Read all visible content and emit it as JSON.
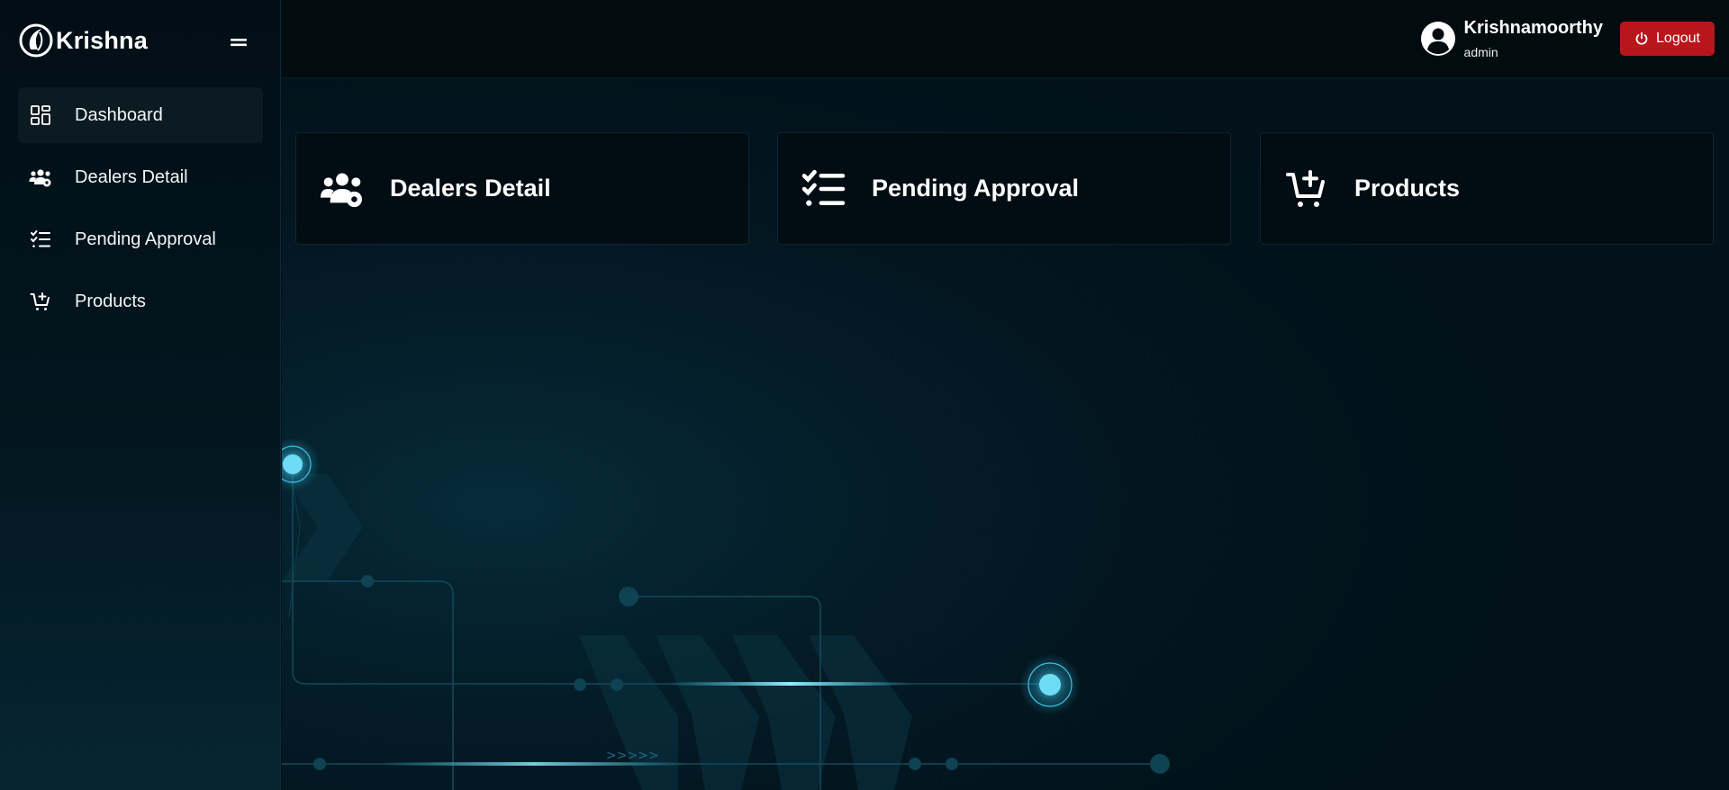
{
  "brand": {
    "name": "Krishna",
    "logo_icon": "krishna-logo"
  },
  "sidebar": {
    "toggle_icon": "menu-toggle-icon",
    "items": [
      {
        "label": "Dashboard",
        "icon": "dashboard-icon",
        "active": true
      },
      {
        "label": "Dealers Detail",
        "icon": "dealers-icon",
        "active": false
      },
      {
        "label": "Pending Approval",
        "icon": "checklist-icon",
        "active": false
      },
      {
        "label": "Products",
        "icon": "cart-plus-icon",
        "active": false
      }
    ]
  },
  "header": {
    "user": {
      "name": "Krishnamoorthy",
      "role": "admin",
      "icon": "user-avatar-icon"
    },
    "logout_label": "Logout",
    "logout_icon": "power-icon"
  },
  "cards": [
    {
      "label": "Dealers Detail",
      "icon": "dealers-icon"
    },
    {
      "label": "Pending Approval",
      "icon": "checklist-icon"
    },
    {
      "label": "Products",
      "icon": "cart-plus-icon"
    }
  ],
  "colors": {
    "background": "#02111a",
    "sidebar": "#03161f",
    "logout_button": "#b8161c",
    "accent_glow": "#4fd3f0"
  }
}
